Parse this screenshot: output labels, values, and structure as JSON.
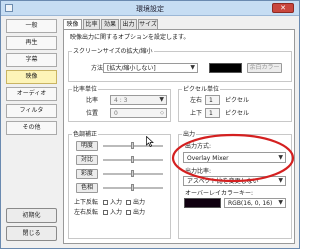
{
  "window": {
    "title": "環境設定",
    "close_glyph": "✕"
  },
  "sidebar": {
    "items": [
      {
        "label": "一般"
      },
      {
        "label": "再生"
      },
      {
        "label": "字幕"
      },
      {
        "label": "映像"
      },
      {
        "label": "オーディオ"
      },
      {
        "label": "フィルタ"
      },
      {
        "label": "その他"
      }
    ],
    "active_index": 3,
    "init_label": "初期化",
    "close_label": "閉じる"
  },
  "tabs": [
    {
      "label": "映像"
    },
    {
      "label": "比率"
    },
    {
      "label": "効果"
    },
    {
      "label": "出力"
    },
    {
      "label": "サイズ"
    }
  ],
  "main": {
    "description": "映像出力に関するオプションを設定します。",
    "screen_size": {
      "title": "スクリーンサイズの拡大/縮小",
      "method_label": "方法",
      "method_value": "[拡大/縮小しない]",
      "bg_color_label": "余白カラー"
    },
    "aspect": {
      "title": "比率単位",
      "ratio_label": "比率",
      "ratio_value": "4 : 3",
      "position_label": "位置",
      "position_value": "0"
    },
    "pixel_unit": {
      "title": "ピクセル単位",
      "lr_label": "左右",
      "lr_value": "1",
      "lr_unit": "ピクセル",
      "tb_label": "上下",
      "tb_value": "1",
      "tb_unit": "ピクセル"
    },
    "color_correction": {
      "title": "色調補正",
      "rows": [
        {
          "label": "明度"
        },
        {
          "label": "対比"
        },
        {
          "label": "彩度"
        },
        {
          "label": "色相"
        }
      ],
      "flip_v_label": "上下反転",
      "flip_h_label": "左右反転",
      "opt_input": "入力",
      "opt_output": "出力"
    },
    "output": {
      "title": "出力",
      "method_label": "出力方式:",
      "method_value": "Overlay Mixer",
      "ratio_label": "出力比率:",
      "ratio_value": "アスペクト比を変更しない",
      "overlay_label": "オーバーレイカラーキー:",
      "overlay_value": "RGB(16, 0, 16)",
      "overlay_color": "#100010"
    }
  },
  "annotation": {
    "color": "#d42020"
  }
}
